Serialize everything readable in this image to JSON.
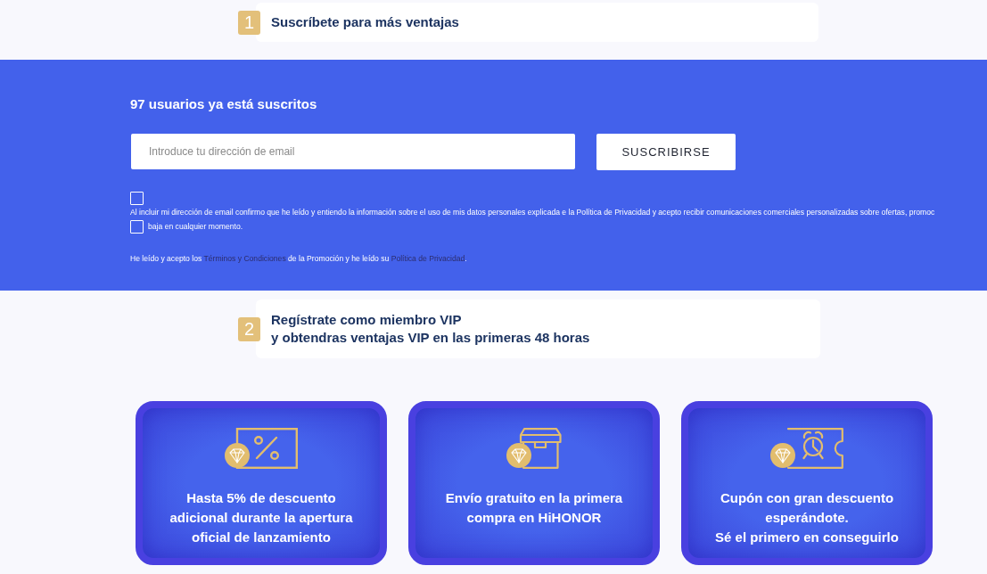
{
  "subscribe_step": {
    "number": "1",
    "title_lines": [
      "Suscríbete para más ventajas"
    ]
  },
  "subscribe_panel": {
    "count_text": "97 usuarios ya está suscritos",
    "email_field": {
      "placeholder": "Introduce tu dirección de email"
    },
    "button": "SUSCRIBIRSE",
    "consent": {
      "checked": false,
      "text_lines": [
        "Al incluir mi dirección de email confirmo que he leído y entiendo la información sobre el uso de mis datos personales explicada e la Política de Privacidad y acepto recibir comunicaciones comerciales personalizadas sobre ofertas, promoc",
        "baja en cualquier momento."
      ]
    },
    "terms": {
      "checked": false,
      "parts": [
        {
          "kind": "text",
          "text": "He leído y acepto los "
        },
        {
          "kind": "link",
          "text": "Términos y Condiciones"
        },
        {
          "kind": "text",
          "text": " de la Promoción y he leído su "
        },
        {
          "kind": "link",
          "text": "Política de Privacidad"
        },
        {
          "kind": "text",
          "text": "."
        }
      ]
    }
  },
  "vip_step": {
    "number": "2",
    "title_lines": [
      "Regístrate como miembro VIP",
      "y obtendras ventajas VIP en las primeras 48 horas"
    ]
  },
  "vip_benefits": [
    {
      "kind": "discount",
      "text_lines": [
        "Hasta 5% de descuento",
        "adicional durante la apertura",
        "oficial de lanzamiento"
      ]
    },
    {
      "kind": "shipping",
      "text_lines": [
        "Envío gratuito en la primera",
        "compra en HiHONOR"
      ]
    },
    {
      "kind": "coupon",
      "text_lines": [
        "Cupón con gran descuento",
        "esperándote.",
        "Sé el primero en conseguirlo"
      ]
    }
  ]
}
